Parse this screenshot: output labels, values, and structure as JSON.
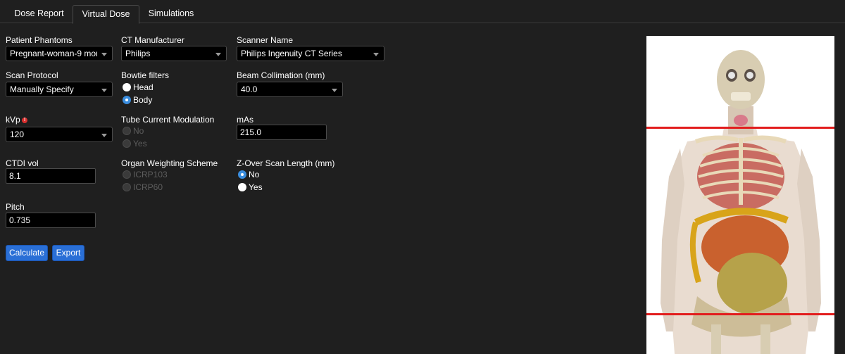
{
  "tabs": [
    {
      "label": "Dose Report"
    },
    {
      "label": "Virtual Dose"
    },
    {
      "label": "Simulations"
    }
  ],
  "active_tab": "Virtual Dose",
  "form": {
    "patient_phantoms": {
      "label": "Patient Phantoms",
      "value": "Pregnant-woman-9 mor"
    },
    "ct_manufacturer": {
      "label": "CT Manufacturer",
      "value": "Philips"
    },
    "scanner_name": {
      "label": "Scanner Name",
      "value": "Philips Ingenuity CT Series"
    },
    "scan_protocol": {
      "label": "Scan Protocol",
      "value": "Manually Specify"
    },
    "bowtie_filters": {
      "label": "Bowtie filters",
      "options": [
        "Head",
        "Body"
      ],
      "selected": "Body"
    },
    "beam_collimation": {
      "label": "Beam Collimation (mm)",
      "value": "40.0"
    },
    "kvp": {
      "label": "kVp",
      "value": "120"
    },
    "tube_current_modulation": {
      "label": "Tube Current Modulation",
      "options": [
        "No",
        "Yes"
      ],
      "disabled": true
    },
    "mas": {
      "label": "mAs",
      "value": "215.0"
    },
    "ctdi_vol": {
      "label": "CTDI vol",
      "value": "8.1"
    },
    "organ_weighting_scheme": {
      "label": "Organ Weighting Scheme",
      "options": [
        "ICRP103",
        "ICRP60"
      ],
      "disabled": true
    },
    "z_over_scan_length": {
      "label": "Z-Over Scan Length (mm)",
      "options": [
        "No",
        "Yes"
      ],
      "selected": "No"
    },
    "pitch": {
      "label": "Pitch",
      "value": "0.735"
    }
  },
  "buttons": {
    "calculate": "Calculate",
    "export": "Export"
  },
  "icons": {
    "kvp_warning": "warning-icon"
  },
  "colors": {
    "accent": "#2a6fd6",
    "radio_selected": "#3a8dde",
    "scan_range_line": "#e21d1d",
    "background": "#1f1f1f"
  }
}
